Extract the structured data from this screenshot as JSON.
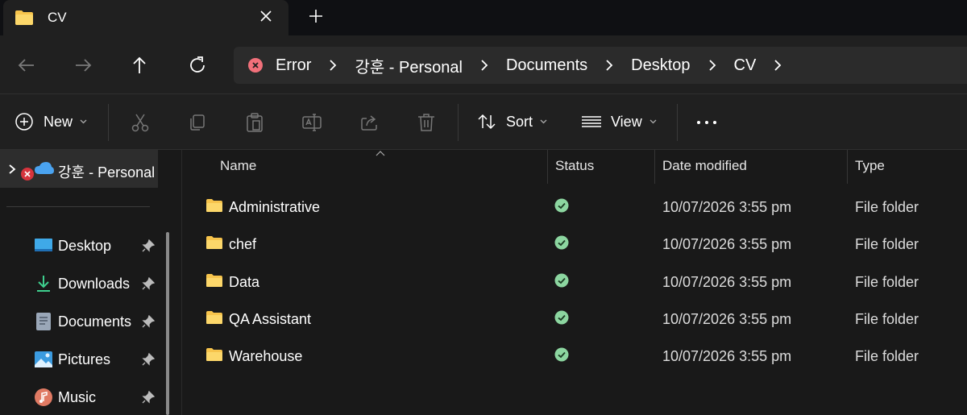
{
  "tab": {
    "title": "CV",
    "close_icon": "close-icon",
    "new_tab_icon": "plus-icon"
  },
  "nav": {
    "back_icon": "arrow-left-icon",
    "forward_icon": "arrow-right-icon",
    "up_icon": "arrow-up-icon",
    "refresh_icon": "refresh-icon"
  },
  "address": {
    "error_label": "Error",
    "crumbs": [
      "강훈 - Personal",
      "Documents",
      "Desktop",
      "CV"
    ]
  },
  "toolbar": {
    "new_label": "New",
    "sort_label": "Sort",
    "view_label": "View",
    "icons": [
      "cut-icon",
      "copy-icon",
      "paste-icon",
      "rename-icon",
      "share-icon",
      "delete-icon"
    ],
    "more_icon": "more-icon"
  },
  "sidebar": {
    "onedrive_label": "강훈 - Personal",
    "items": [
      {
        "label": "Desktop",
        "icon": "desktop-icon"
      },
      {
        "label": "Downloads",
        "icon": "download-icon"
      },
      {
        "label": "Documents",
        "icon": "document-icon"
      },
      {
        "label": "Pictures",
        "icon": "pictures-icon"
      },
      {
        "label": "Music",
        "icon": "music-icon"
      }
    ]
  },
  "table": {
    "headers": {
      "name": "Name",
      "status": "Status",
      "date": "Date modified",
      "type": "Type"
    },
    "rows": [
      {
        "name": "Administrative",
        "date": "10/07/2026 3:55 pm",
        "type": "File folder"
      },
      {
        "name": "chef",
        "date": "10/07/2026 3:55 pm",
        "type": "File folder"
      },
      {
        "name": "Data",
        "date": "10/07/2026 3:55 pm",
        "type": "File folder"
      },
      {
        "name": "QA Assistant",
        "date": "10/07/2026 3:55 pm",
        "type": "File folder"
      },
      {
        "name": "Warehouse",
        "date": "10/07/2026 3:55 pm",
        "type": "File folder"
      }
    ]
  },
  "colors": {
    "folder": "#f7c44c",
    "status_ok": "#8cd6a0",
    "error": "#f1707a",
    "onedrive": "#4aa3f0"
  }
}
